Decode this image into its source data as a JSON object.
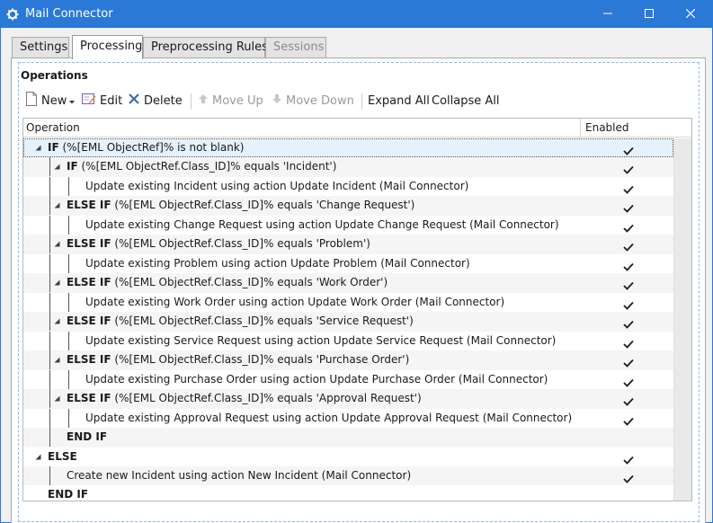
{
  "window": {
    "title": "Mail Connector",
    "app_icon": "gear-icon",
    "controls": [
      "minimize-icon",
      "maximize-icon",
      "close-icon"
    ],
    "accent": "#2b79d6"
  },
  "tabs": [
    {
      "label": "Settings",
      "state": "normal"
    },
    {
      "label": "Processing",
      "state": "active"
    },
    {
      "label": "Preprocessing Rules",
      "state": "normal"
    },
    {
      "label": "Sessions",
      "state": "disabled"
    }
  ],
  "operations": {
    "title": "Operations",
    "toolbar": {
      "new": "New",
      "edit": "Edit",
      "delete": "Delete",
      "move_up": "Move Up",
      "move_down": "Move Down",
      "expand_all": "Expand All",
      "collapse_all": "Collapse All"
    },
    "columns": {
      "operation": "Operation",
      "enabled": "Enabled"
    },
    "rows": [
      {
        "level": 0,
        "toggle": true,
        "keyword": "IF",
        "text": " (%[EML ObjectRef]% is not blank)",
        "enabled": true
      },
      {
        "level": 1,
        "toggle": true,
        "keyword": "IF",
        "text": " (%[EML ObjectRef.Class_ID]% equals 'Incident')",
        "enabled": true
      },
      {
        "level": 2,
        "toggle": false,
        "keyword": "",
        "text": "Update existing Incident using action Update Incident (Mail Connector)",
        "enabled": true
      },
      {
        "level": 1,
        "toggle": true,
        "keyword": "ELSE IF",
        "text": " (%[EML ObjectRef.Class_ID]% equals 'Change Request')",
        "enabled": true
      },
      {
        "level": 2,
        "toggle": false,
        "keyword": "",
        "text": "Update existing Change Request using action Update Change Request (Mail Connector)",
        "enabled": true
      },
      {
        "level": 1,
        "toggle": true,
        "keyword": "ELSE IF",
        "text": " (%[EML ObjectRef.Class_ID]% equals 'Problem')",
        "enabled": true
      },
      {
        "level": 2,
        "toggle": false,
        "keyword": "",
        "text": "Update existing Problem using action Update Problem (Mail Connector)",
        "enabled": true
      },
      {
        "level": 1,
        "toggle": true,
        "keyword": "ELSE IF",
        "text": " (%[EML ObjectRef.Class_ID]% equals 'Work Order')",
        "enabled": true
      },
      {
        "level": 2,
        "toggle": false,
        "keyword": "",
        "text": "Update existing Work Order using action Update Work Order (Mail Connector)",
        "enabled": true
      },
      {
        "level": 1,
        "toggle": true,
        "keyword": "ELSE IF",
        "text": " (%[EML ObjectRef.Class_ID]% equals 'Service Request')",
        "enabled": true
      },
      {
        "level": 2,
        "toggle": false,
        "keyword": "",
        "text": "Update existing Service Request using action Update Service Request (Mail Connector)",
        "enabled": true
      },
      {
        "level": 1,
        "toggle": true,
        "keyword": "ELSE IF",
        "text": " (%[EML ObjectRef.Class_ID]% equals 'Purchase Order')",
        "enabled": true
      },
      {
        "level": 2,
        "toggle": false,
        "keyword": "",
        "text": "Update existing Purchase Order using action Update Purchase Order (Mail Connector)",
        "enabled": true
      },
      {
        "level": 1,
        "toggle": true,
        "keyword": "ELSE IF",
        "text": " (%[EML ObjectRef.Class_ID]% equals 'Approval Request')",
        "enabled": true
      },
      {
        "level": 2,
        "toggle": false,
        "keyword": "",
        "text": "Update existing Approval Request using action Update Approval Request (Mail Connector)",
        "enabled": true
      },
      {
        "level": 1,
        "toggle": false,
        "keyword": "END IF",
        "text": "",
        "enabled": false
      },
      {
        "level": 0,
        "toggle": true,
        "keyword": "ELSE",
        "text": "",
        "enabled": true
      },
      {
        "level": 1,
        "toggle": false,
        "keyword": "",
        "text": "Create new Incident using action New Incident (Mail Connector)",
        "enabled": true
      },
      {
        "level": 0,
        "toggle": false,
        "keyword": "END IF",
        "text": "",
        "enabled": false
      }
    ]
  }
}
